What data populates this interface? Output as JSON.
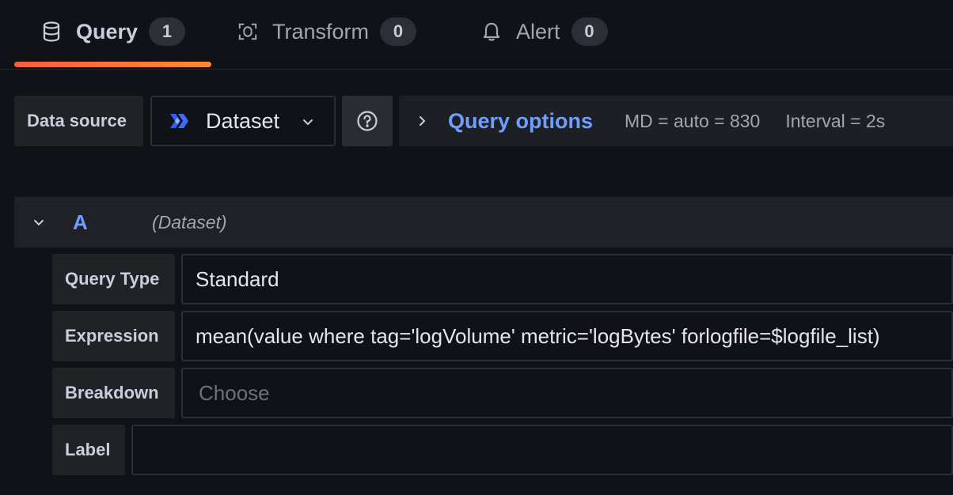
{
  "tabs": [
    {
      "label": "Query",
      "count": "1",
      "icon": "database-icon",
      "active": true
    },
    {
      "label": "Transform",
      "count": "0",
      "icon": "transform-icon",
      "active": false
    },
    {
      "label": "Alert",
      "count": "0",
      "icon": "bell-icon",
      "active": false
    }
  ],
  "datasource": {
    "label": "Data source",
    "selected": "Dataset",
    "logo": "dataset-logo-icon"
  },
  "query_options": {
    "title": "Query options",
    "md": "MD = auto = 830",
    "interval": "Interval = 2s"
  },
  "query": {
    "ref_id": "A",
    "datasource_name": "(Dataset)",
    "fields": {
      "query_type": {
        "label": "Query Type",
        "value": "Standard"
      },
      "expression": {
        "label": "Expression",
        "value": "mean(value where tag='logVolume' metric='logBytes' forlogfile=$logfile_list)"
      },
      "breakdown": {
        "label": "Breakdown",
        "placeholder": "Choose"
      },
      "label": {
        "label": "Label",
        "value": ""
      }
    }
  },
  "colors": {
    "accent_blue": "#6e9fff",
    "tab_underline": "#f55f3e",
    "background": "#111217"
  }
}
